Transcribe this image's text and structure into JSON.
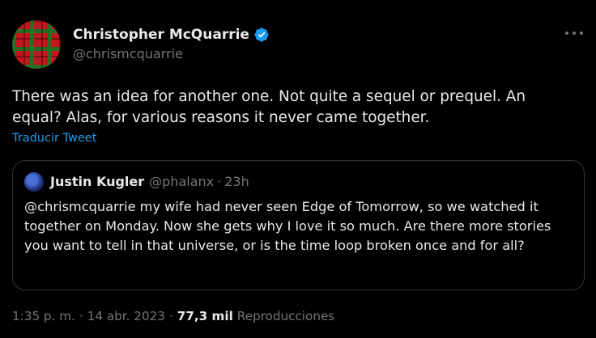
{
  "author": {
    "name": "Christopher McQuarrie",
    "handle": "@chrismcquarrie",
    "verified_icon": "verified-badge-icon",
    "verified_color": "#1d9bf0"
  },
  "tweet": {
    "text": "There was an idea for another one. Not quite a sequel or prequel. An equal? Alas, for various reasons it never came together.",
    "translate_label": "Traducir Tweet"
  },
  "quote": {
    "name": "Justin Kugler",
    "handle": "@phalanx",
    "dot": "·",
    "time": "23h",
    "text": "@chrismcquarrie my wife had never seen Edge of Tomorrow, so we watched it together on Monday. Now she gets why I love it so much. Are there more stories you want to tell in that universe, or is the time loop broken once and for all?"
  },
  "meta": {
    "time": "1:35 p. m.",
    "sep": "·",
    "date": "14 abr. 2023",
    "views_count": "77,3 mil",
    "views_label": "Reproducciones"
  },
  "colors": {
    "background": "#000000",
    "text": "#e7e9ea",
    "muted": "#71767b",
    "accent": "#1d9bf0",
    "border": "#2f3336"
  },
  "icons": {
    "more": "more-horizontal-icon"
  }
}
